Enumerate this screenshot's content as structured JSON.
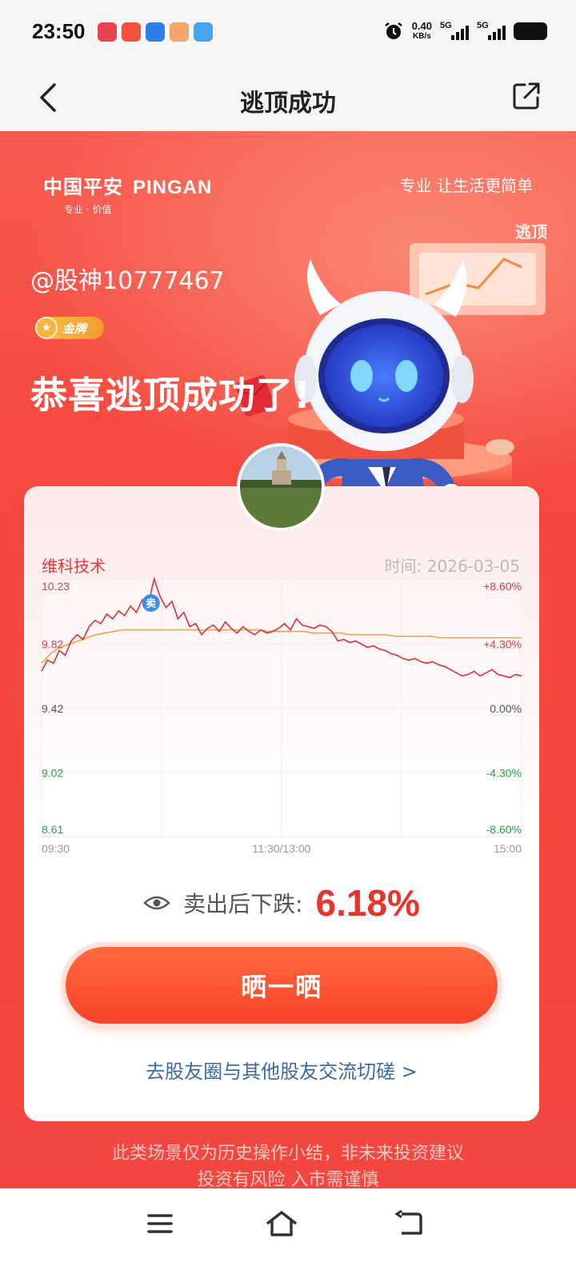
{
  "status_bar": {
    "time": "23:50",
    "net_speed_value": "0.40",
    "net_speed_unit": "KB/s",
    "signal1_label": "5G",
    "signal2_label": "5G"
  },
  "header": {
    "title": "逃顶成功",
    "back_icon": "chevron-left-icon",
    "share_icon": "share-external-icon"
  },
  "hero": {
    "brand_cn": "中国平安",
    "brand_en": "PINGAN",
    "brand_sub": "专业 · 价值",
    "slogan": "专业 让生活更简单",
    "escape_tag": "逃顶",
    "username": "@股神10777467",
    "badge_label": "金牌",
    "headline": "恭喜逃顶成功了!"
  },
  "card": {
    "stock_name": "维科技术",
    "time_label": "时间: 2026-03-05",
    "result_label": "卖出后下跌:",
    "result_value": "6.18%",
    "share_button": "晒一晒",
    "community_link": "去股友圈与其他股友交流切磋 >"
  },
  "chart_data": {
    "type": "line",
    "sell_marker": "卖",
    "y_left_ticks": [
      "10.23",
      "9.82",
      "9.42",
      "9.02",
      "8.61"
    ],
    "y_right_ticks": [
      "+8.60%",
      "+4.30%",
      "0.00%",
      "-4.30%",
      "-8.60%"
    ],
    "x_ticks": [
      "09:30",
      "11:30/13:00",
      "15:00"
    ],
    "ylim": [
      8.61,
      10.23
    ],
    "colors": {
      "price": "#d9303a",
      "avg": "#efa340",
      "up": "#e03b3b",
      "down": "#2aa04a",
      "neutral": "#555555"
    },
    "series": [
      {
        "values": [
          9.65,
          9.72,
          9.7,
          9.78,
          9.75,
          9.84,
          9.88,
          9.85,
          9.93,
          9.97,
          9.95,
          10.01,
          9.98,
          10.03,
          10.0,
          10.06,
          10.02,
          10.1,
          10.07,
          10.23,
          10.12,
          10.05,
          10.09,
          9.98,
          10.02,
          9.93,
          9.95,
          9.88,
          9.92,
          9.94,
          9.9,
          9.96,
          9.92,
          9.89,
          9.93,
          9.9,
          9.88,
          9.91,
          9.89,
          9.9,
          9.92,
          9.95,
          9.91,
          9.98,
          9.94,
          9.93,
          9.92,
          9.94,
          9.93,
          9.9,
          9.84,
          9.85,
          9.83,
          9.84,
          9.82,
          9.8,
          9.81,
          9.79,
          9.78,
          9.76,
          9.75,
          9.73,
          9.72,
          9.73,
          9.71,
          9.7,
          9.71,
          9.69,
          9.68,
          9.66,
          9.64,
          9.62,
          9.63,
          9.65,
          9.62,
          9.64,
          9.66,
          9.63,
          9.62,
          9.61,
          9.63,
          9.62
        ]
      },
      {
        "values": [
          9.7,
          9.76,
          9.8,
          9.82,
          9.84,
          9.86,
          9.88,
          9.89,
          9.9,
          9.91,
          9.91,
          9.91,
          9.91,
          9.91,
          9.91,
          9.91,
          9.91,
          9.91,
          9.91,
          9.91,
          9.91,
          9.91,
          9.91,
          9.91,
          9.91,
          9.9,
          9.9,
          9.9,
          9.9,
          9.9,
          9.89,
          9.89,
          9.89,
          9.89,
          9.88,
          9.88,
          9.88,
          9.88,
          9.88,
          9.87,
          9.87,
          9.87,
          9.87,
          9.87,
          9.86,
          9.86,
          9.86,
          9.86,
          9.86,
          9.86,
          9.86,
          9.86,
          9.86,
          9.86
        ]
      }
    ]
  },
  "disclaimer": {
    "line1": "此类场景仅为历史操作小结，非未来投资建议",
    "line2": "投资有风险 入市需谨慎"
  },
  "bottom_nav": {
    "menu_icon": "menu-icon",
    "home_icon": "home-icon",
    "back_icon": "back-icon"
  }
}
